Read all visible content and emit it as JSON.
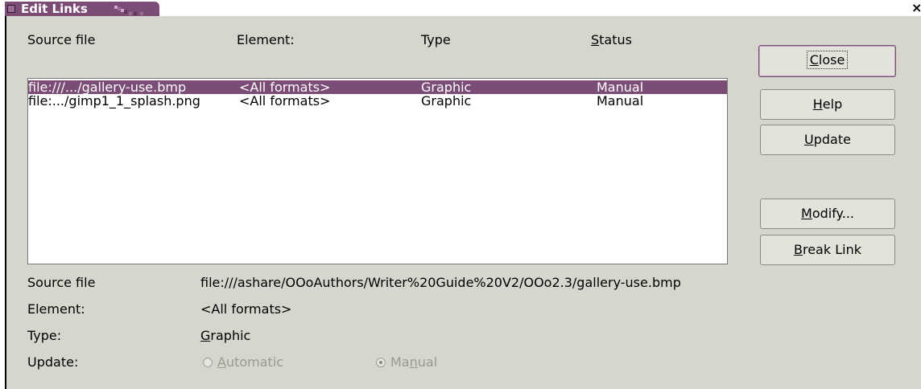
{
  "window": {
    "title": "Edit Links",
    "close_glyph": "×"
  },
  "columns": [
    {
      "label": "Source file"
    },
    {
      "label": "Element:"
    },
    {
      "label": "Type"
    },
    {
      "label_pre": "",
      "label_u": "S",
      "label_post": "tatus"
    }
  ],
  "links": [
    {
      "source": "file:///.../gallery-use.bmp",
      "element": "<All formats>",
      "type": "Graphic",
      "status": "Manual",
      "selected": true
    },
    {
      "source": "file:.../gimp1_1_splash.png",
      "element": "<All formats>",
      "type": "Graphic",
      "status": "Manual",
      "selected": false
    }
  ],
  "buttons": {
    "close": {
      "pre": "",
      "u": "C",
      "post": "lose"
    },
    "help": {
      "pre": "",
      "u": "H",
      "post": "elp"
    },
    "update": {
      "pre": "",
      "u": "U",
      "post": "pdate"
    },
    "modify": {
      "pre": "",
      "u": "M",
      "post": "odify..."
    },
    "breaklink": {
      "pre": "",
      "u": "B",
      "post": "reak Link"
    }
  },
  "details": {
    "source_label": "Source file",
    "source_value": "file:///ashare/OOoAuthors/Writer%20Guide%20V2/OOo2.3/gallery-use.bmp",
    "element_label": "Element:",
    "element_value": "<All formats>",
    "type_label": "Type:",
    "type_value": {
      "pre": "",
      "u": "G",
      "post": "raphic"
    },
    "update_label": "Update:",
    "update_automatic": {
      "pre": "",
      "u": "A",
      "post": "utomatic",
      "checked": false,
      "enabled": false
    },
    "update_manual": {
      "pre": "Ma",
      "u": "n",
      "post": "ual",
      "checked": true,
      "enabled": false
    }
  },
  "colors": {
    "accent": "#7b4c75",
    "dialog_bg": "#d6d6ce",
    "selection_text": "#ffffff"
  }
}
